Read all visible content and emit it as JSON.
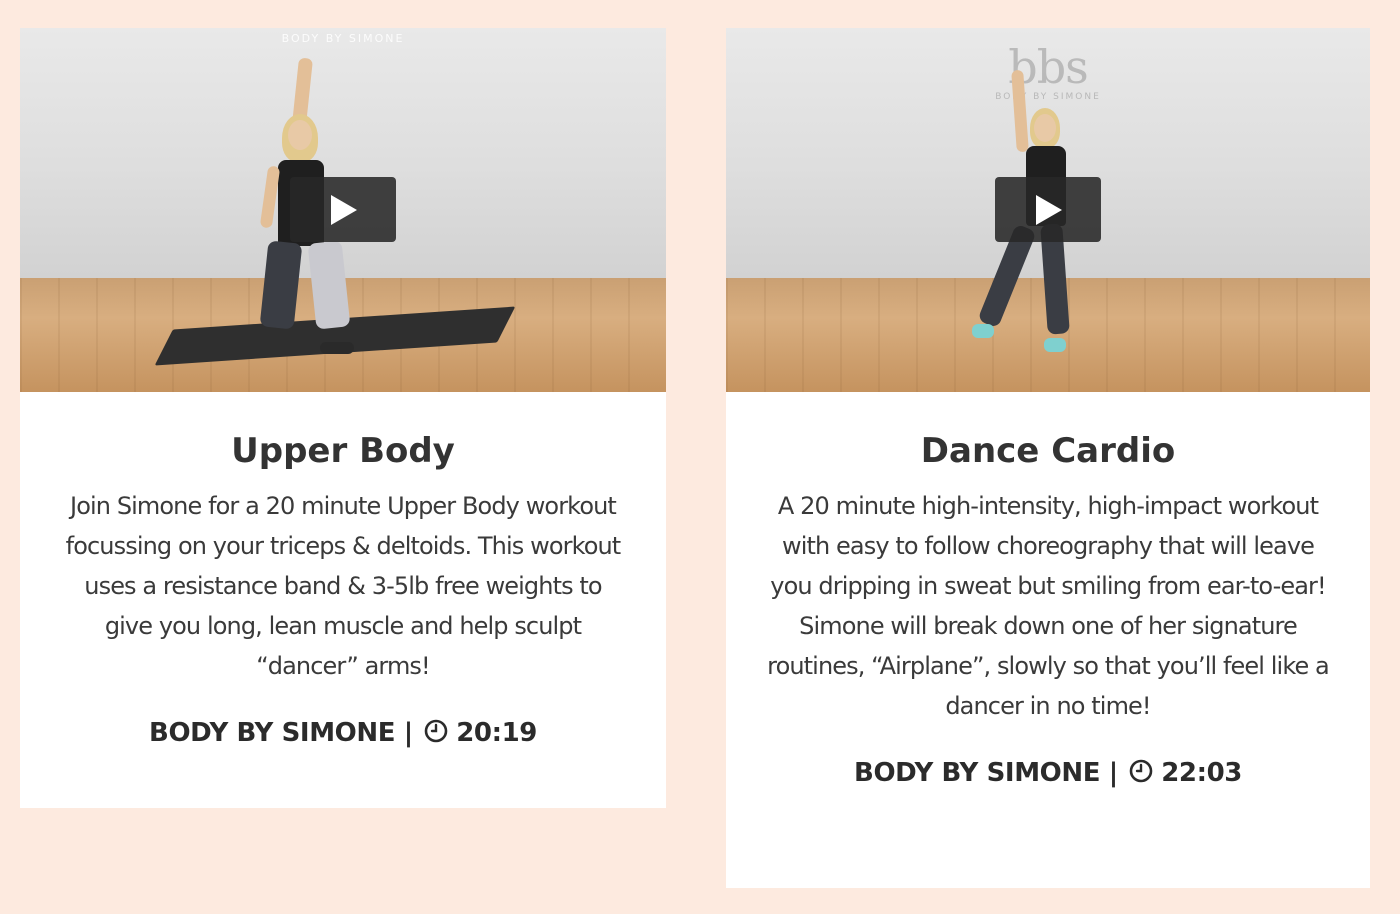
{
  "cards": [
    {
      "watermark": "BODY BY SIMONE",
      "play_label": "Play video",
      "title": "Upper Body",
      "description": "Join Simone for a 20 minute Upper Body workout focussing on your triceps & deltoids. This workout uses a resistance band & 3-5lb free weights to give you long, lean muscle and help sculpt “dancer” arms!",
      "brand": "BODY BY SIMONE",
      "separator": "|",
      "duration": "20:19",
      "icon": "clock-icon"
    },
    {
      "watermark_logo": "bbs",
      "watermark": "BODY BY SIMONE",
      "play_label": "Play video",
      "title": "Dance Cardio",
      "description": "A 20 minute high-intensity, high-impact workout with easy to follow choreography that will leave you dripping in sweat but smiling from ear-to-ear! Simone will break down one of her signature routines, “Airplane”, slowly so that you’ll feel like a dancer in no time!",
      "brand": "BODY BY SIMONE",
      "separator": "|",
      "duration": "22:03",
      "icon": "clock-icon"
    }
  ],
  "colors": {
    "page_background": "#fdeadf",
    "card_background": "#ffffff",
    "text": "#333333",
    "play_button": "#282828"
  }
}
